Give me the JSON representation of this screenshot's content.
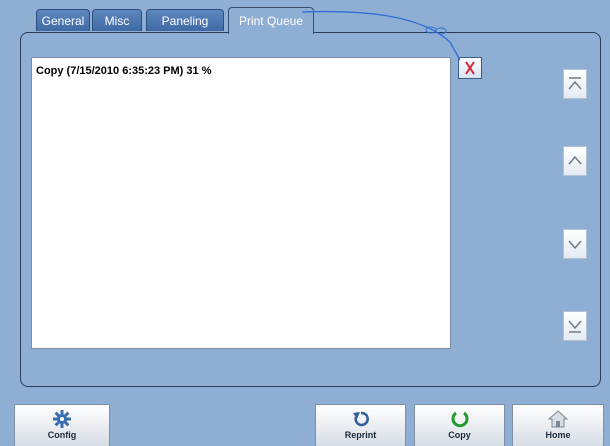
{
  "tabs": [
    {
      "label": "General"
    },
    {
      "label": "Misc"
    },
    {
      "label": "Paneling"
    },
    {
      "label": "Print Queue",
      "active": true
    }
  ],
  "queue": {
    "items": [
      {
        "text": "Copy (7/15/2010 6:35:23 PM)  31 %"
      }
    ]
  },
  "icons": {
    "delete": "delete-x-icon",
    "scroll_top": "scroll-top-icon",
    "scroll_up": "scroll-up-icon",
    "scroll_down": "scroll-down-icon",
    "scroll_bottom": "scroll-bottom-icon"
  },
  "bottom_bar": {
    "config": {
      "label": "Config",
      "icon": "gear-icon"
    },
    "reprint": {
      "label": "Reprint",
      "icon": "reprint-icon"
    },
    "copy": {
      "label": "Copy",
      "icon": "copy-icon"
    },
    "home": {
      "label": "Home",
      "icon": "home-icon"
    }
  },
  "colors": {
    "background": "#8eaed3",
    "tab": "#4a74ad",
    "delete_x": "#d0243a",
    "reprint_icon": "#2f5f9e",
    "copy_icon": "#1f9a2e",
    "annotation_line": "#2f6fd6"
  }
}
